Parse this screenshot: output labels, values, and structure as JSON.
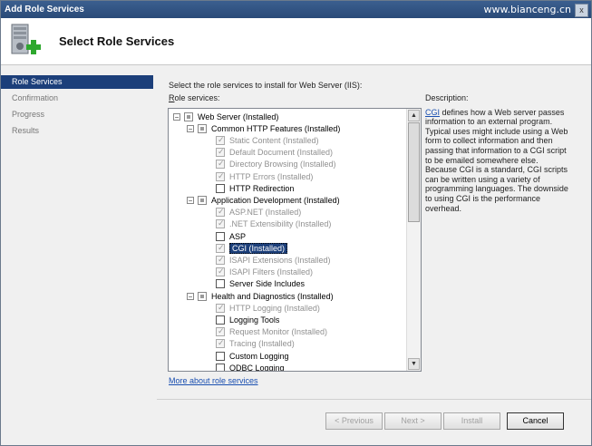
{
  "window": {
    "title": "Add Role Services",
    "watermark": "www.bianceng.cn",
    "close_glyph": "x"
  },
  "header": {
    "title": "Select Role Services",
    "icon": "server-add-icon"
  },
  "sidebar": {
    "steps": [
      {
        "label": "Role Services",
        "active": true
      },
      {
        "label": "Confirmation",
        "active": false
      },
      {
        "label": "Progress",
        "active": false
      },
      {
        "label": "Results",
        "active": false
      }
    ]
  },
  "main": {
    "intro": "Select the role services to install for Web Server (IIS):",
    "role_services_label_prefix": "R",
    "role_services_label_rest": "ole services:",
    "tree": [
      {
        "label": "Web Server  (Installed)",
        "level": 0,
        "expander": "−",
        "state": "partial",
        "dim": false
      },
      {
        "label": "Common HTTP Features  (Installed)",
        "level": 1,
        "expander": "−",
        "state": "partial",
        "dim": false
      },
      {
        "label": "Static Content  (Installed)",
        "level": 2,
        "state": "checked",
        "dim": true
      },
      {
        "label": "Default Document  (Installed)",
        "level": 2,
        "state": "checked",
        "dim": true
      },
      {
        "label": "Directory Browsing  (Installed)",
        "level": 2,
        "state": "checked",
        "dim": true
      },
      {
        "label": "HTTP Errors  (Installed)",
        "level": 2,
        "state": "checked",
        "dim": true
      },
      {
        "label": "HTTP Redirection",
        "level": 2,
        "state": "unchecked",
        "dim": false
      },
      {
        "label": "Application Development  (Installed)",
        "level": 1,
        "expander": "−",
        "state": "partial",
        "dim": false
      },
      {
        "label": "ASP.NET  (Installed)",
        "level": 2,
        "state": "checked",
        "dim": true
      },
      {
        "label": ".NET Extensibility  (Installed)",
        "level": 2,
        "state": "checked",
        "dim": true
      },
      {
        "label": "ASP",
        "level": 2,
        "state": "unchecked",
        "dim": false
      },
      {
        "label": "CGI  (Installed)",
        "level": 2,
        "state": "checked",
        "dim": false,
        "selected": true
      },
      {
        "label": "ISAPI Extensions  (Installed)",
        "level": 2,
        "state": "checked",
        "dim": true
      },
      {
        "label": "ISAPI Filters  (Installed)",
        "level": 2,
        "state": "checked",
        "dim": true
      },
      {
        "label": "Server Side Includes",
        "level": 2,
        "state": "unchecked",
        "dim": false
      },
      {
        "label": "Health and Diagnostics  (Installed)",
        "level": 1,
        "expander": "−",
        "state": "partial",
        "dim": false
      },
      {
        "label": "HTTP Logging  (Installed)",
        "level": 2,
        "state": "checked",
        "dim": true
      },
      {
        "label": "Logging Tools",
        "level": 2,
        "state": "unchecked",
        "dim": false
      },
      {
        "label": "Request Monitor  (Installed)",
        "level": 2,
        "state": "checked",
        "dim": true
      },
      {
        "label": "Tracing  (Installed)",
        "level": 2,
        "state": "checked",
        "dim": true
      },
      {
        "label": "Custom Logging",
        "level": 2,
        "state": "unchecked",
        "dim": false
      },
      {
        "label": "ODBC Logging",
        "level": 2,
        "state": "unchecked",
        "dim": false
      }
    ],
    "description_label": "Description:",
    "description_link": "CGI",
    "description_text": " defines how a Web server passes information to an external program. Typical uses might include using a Web form to collect information and then passing that information to a CGI script to be emailed somewhere else. Because CGI is a standard, CGI scripts can be written using a variety of programming languages. The downside to using CGI is the performance overhead.",
    "more_link": "More about role services"
  },
  "buttons": {
    "previous": {
      "label": "< Previous",
      "enabled": false
    },
    "next": {
      "label": "Next >",
      "enabled": false
    },
    "install": {
      "label": "Install",
      "enabled": false
    },
    "cancel": {
      "label": "Cancel",
      "enabled": true
    }
  },
  "colors": {
    "selection": "#1c3f7a",
    "link": "#1a4fb0",
    "titlebar": "#2a4a78"
  }
}
